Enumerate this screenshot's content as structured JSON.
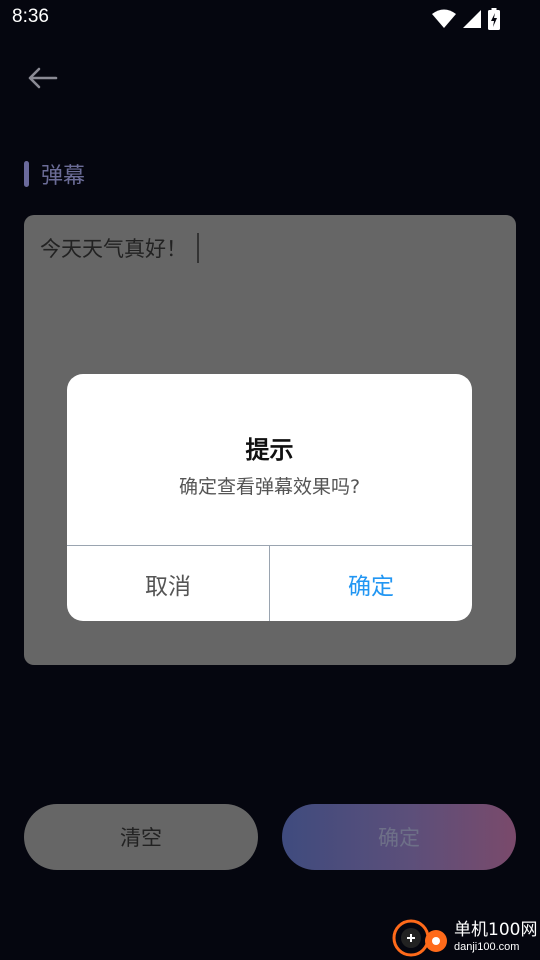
{
  "status_bar": {
    "time": "8:36"
  },
  "header": {
    "back_icon": "arrow-left-icon"
  },
  "section": {
    "title": "弹幕"
  },
  "editor": {
    "text": "今天天气真好！"
  },
  "buttons": {
    "clear_label": "清空",
    "confirm_label": "确定"
  },
  "dialog": {
    "title": "提示",
    "message": "确定查看弹幕效果吗?",
    "cancel_label": "取消",
    "ok_label": "确定"
  },
  "watermark": {
    "main": "单机100网",
    "sub": "danji100.com"
  },
  "colors": {
    "accent": "#2196f3",
    "background": "#05060f",
    "editor_bg": "#666666"
  }
}
